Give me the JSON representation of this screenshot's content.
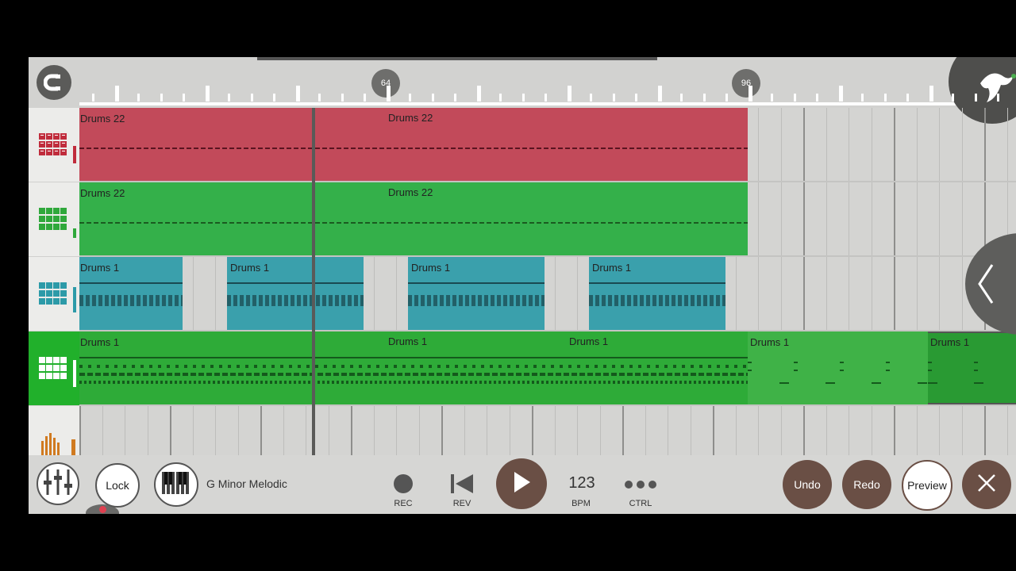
{
  "app": {
    "ruler": {
      "markers": [
        "64",
        "96"
      ]
    },
    "tracks": [
      {
        "clips": [
          "Drums 22",
          "Drums 22"
        ],
        "color": "#c24a5a"
      },
      {
        "clips": [
          "Drums 22",
          "Drums 22"
        ],
        "color": "#34b04a"
      },
      {
        "clips": [
          "Drums 1",
          "Drums 1",
          "Drums 1",
          "Drums 1"
        ],
        "color": "#3aa0ac"
      },
      {
        "clips": [
          "Drums 1",
          "Drums 1",
          "Drums 1",
          "Drums 1",
          "Drums 1"
        ],
        "color": "#2eab38"
      }
    ],
    "toolbar": {
      "lock_label": "Lock",
      "scale_label": "G Minor Melodic",
      "rec_label": "REC",
      "rev_label": "REV",
      "tempo_value": "123",
      "bpm_label": "BPM",
      "ctrl_label": "CTRL",
      "undo_label": "Undo",
      "redo_label": "Redo",
      "preview_label": "Preview"
    },
    "icons": {
      "snap": "magnet-snap-icon",
      "track": "drum-pads-icon",
      "mixer": "mixer-sliders-icon",
      "piano": "piano-keys-icon",
      "record": "record-icon",
      "rewind": "rewind-icon",
      "play": "play-icon",
      "more": "more-dots-icon",
      "close": "close-icon",
      "collapse": "chevron-left-icon",
      "corner": "bird-logo-icon"
    }
  }
}
